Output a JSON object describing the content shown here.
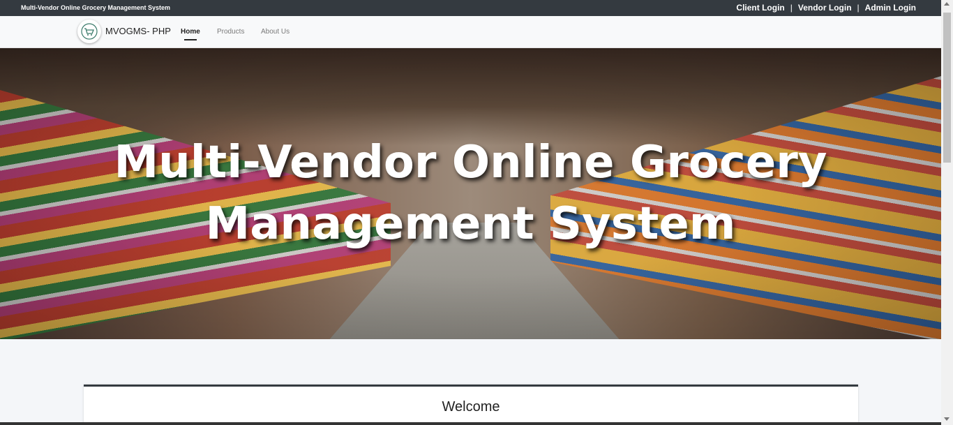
{
  "topbar": {
    "site_name": "Multi-Vendor Online Grocery Management System",
    "links": [
      {
        "label": "Client Login"
      },
      {
        "label": "Vendor Login"
      },
      {
        "label": "Admin Login"
      }
    ],
    "separator": "|"
  },
  "navbar": {
    "brand": "MVOGMS- PHP",
    "links": [
      {
        "label": "Home",
        "active": true
      },
      {
        "label": "Products",
        "active": false
      },
      {
        "label": "About Us",
        "active": false
      }
    ]
  },
  "hero": {
    "title_line1": "Multi-Vendor Online Grocery",
    "title_line2": "Management System"
  },
  "welcome": {
    "title": "Welcome"
  },
  "colors": {
    "topbar_bg": "#343a40",
    "navbar_bg": "#f8f9fa",
    "page_bg": "#f4f6f9"
  }
}
